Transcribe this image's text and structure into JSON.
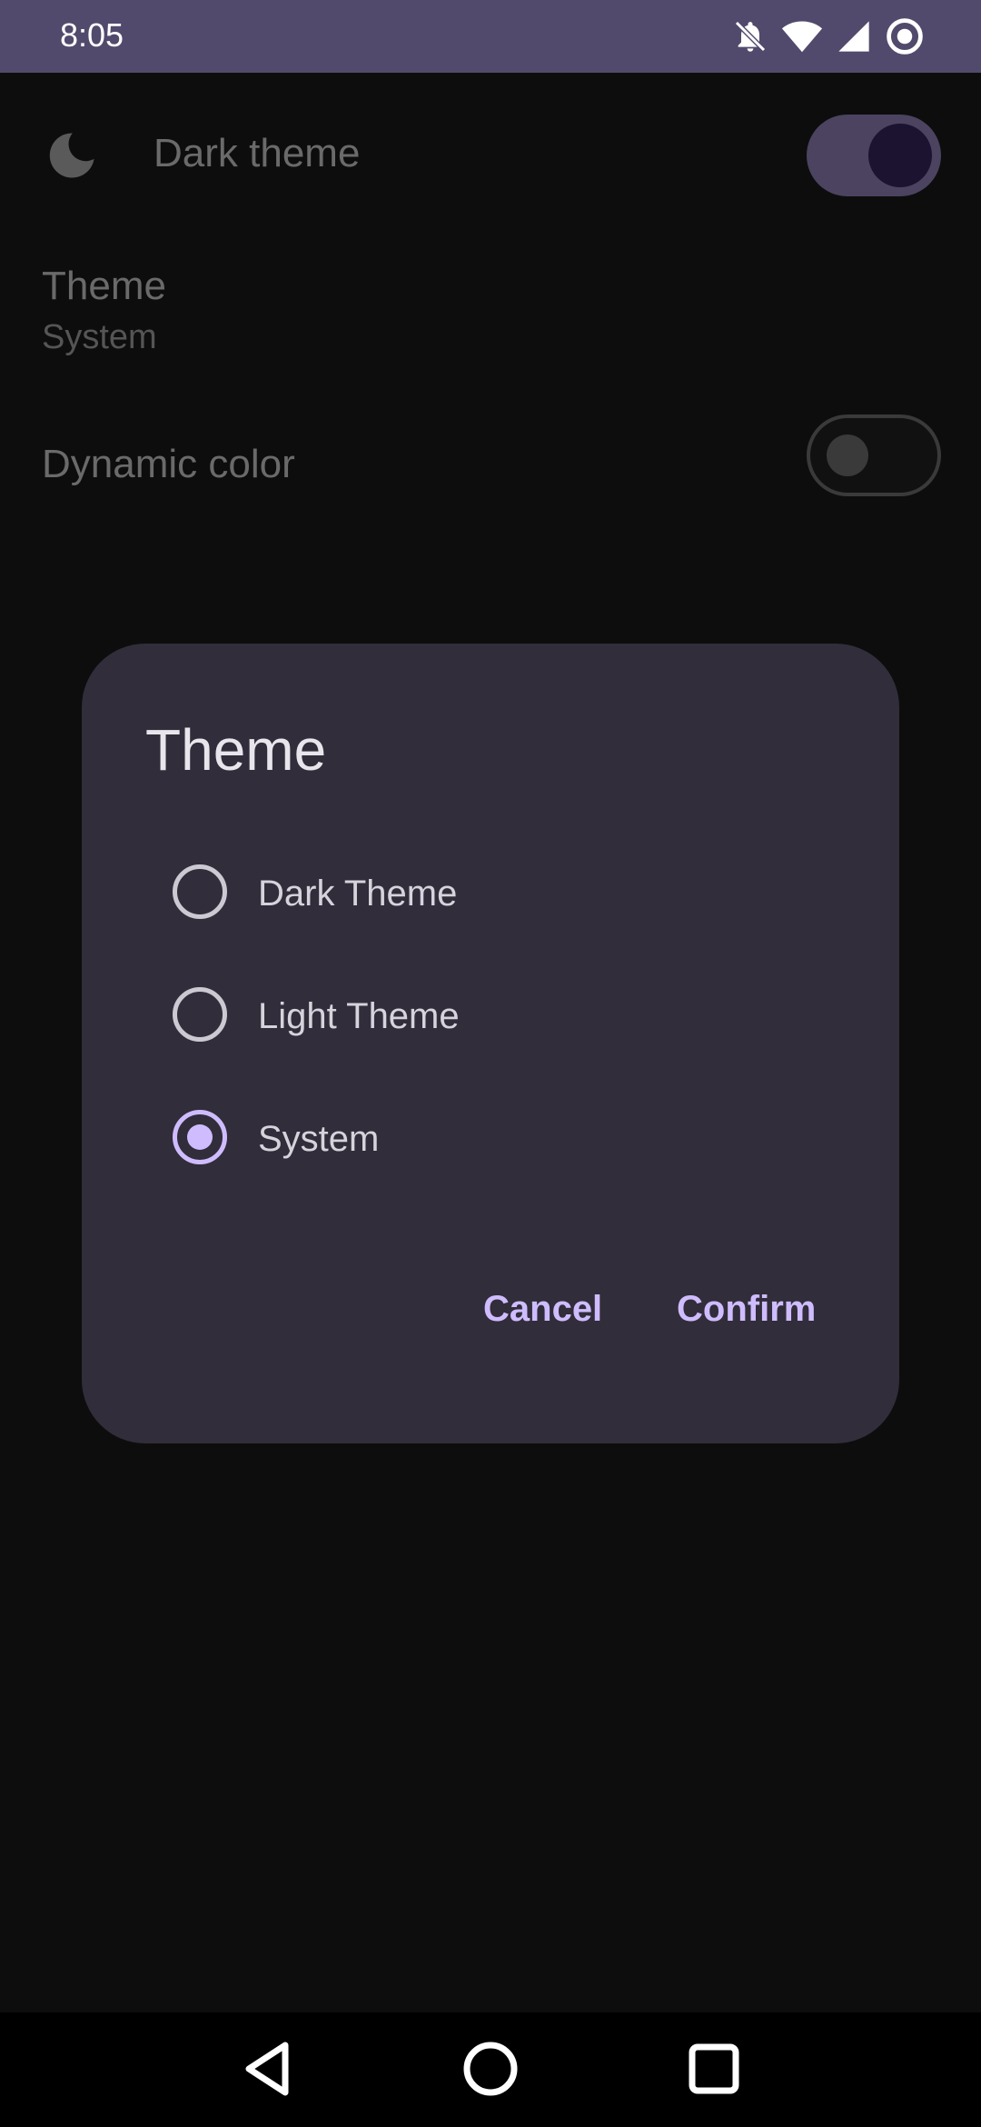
{
  "status_bar": {
    "time": "8:05",
    "icons": [
      "notifications-off-icon",
      "wifi-icon",
      "signal-icon",
      "record-icon"
    ]
  },
  "settings": {
    "dark_theme": {
      "label": "Dark theme",
      "icon": "moon-icon",
      "enabled": true
    },
    "theme": {
      "label": "Theme",
      "value": "System"
    },
    "dynamic_color": {
      "label": "Dynamic color",
      "enabled": false
    }
  },
  "dialog": {
    "title": "Theme",
    "options": [
      {
        "label": "Dark Theme",
        "selected": false
      },
      {
        "label": "Light Theme",
        "selected": false
      },
      {
        "label": "System",
        "selected": true
      }
    ],
    "cancel_label": "Cancel",
    "confirm_label": "Confirm"
  },
  "nav_bar": {
    "icons": [
      "back-icon",
      "home-icon",
      "recents-icon"
    ]
  },
  "colors": {
    "accent": "#cfbcff",
    "status_bar_bg": "#524a6c",
    "dialog_bg": "#312d3a",
    "screen_bg": "#0d0d0d"
  }
}
